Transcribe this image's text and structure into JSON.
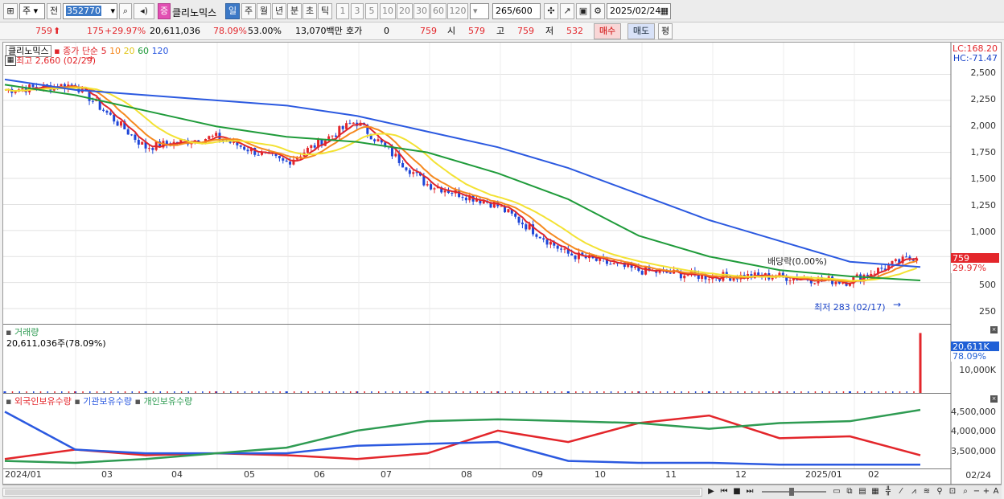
{
  "toolbar": {
    "market_sel": "주",
    "prefix_label": "전",
    "code_value": "352770",
    "stock_name": "클리노믹스",
    "kind_badge": "증",
    "periods": [
      "일",
      "주",
      "월",
      "년",
      "분",
      "초",
      "틱"
    ],
    "active_period": "일",
    "intervals": [
      "1",
      "3",
      "5",
      "10",
      "20",
      "30",
      "60",
      "120"
    ],
    "count_value": "265",
    "count_total": "/600",
    "date_value": "2025/02/24"
  },
  "quote": {
    "price": "759",
    "change": "175",
    "change_pct": "+29.97%",
    "volume": "20,611,036",
    "vol_ratio": "78.09%",
    "rate2": "53.00%",
    "amount": "13,070백만",
    "hoga_label": "호가",
    "hoga_value": "0",
    "hoga_price": "759",
    "open_label": "시",
    "open_value": "579",
    "high_label": "고",
    "high_value": "759",
    "low_label": "저",
    "low_value": "532",
    "buy_label": "매수",
    "sell_label": "매도",
    "avg_label": "평"
  },
  "price_panel": {
    "legend_name": "클리노믹스",
    "legend_ma": "종가 단순",
    "ma_periods": [
      "5",
      "10",
      "20",
      "60",
      "120"
    ],
    "lc_label": "LC:168.20",
    "hc_label": "HC:-71.47",
    "high_marker": "최고 2,660 (02/29)",
    "low_marker": "최저 283 (02/17)",
    "dividend_marker": "배당락(0.00%)",
    "last_price_tag": "759",
    "last_pct_tag": "29.97%",
    "y_ticks": [
      "2,500",
      "2,250",
      "2,000",
      "1,750",
      "1,500",
      "1,250",
      "1,000",
      "750",
      "500",
      "250"
    ]
  },
  "volume_panel": {
    "title": "거래량",
    "value_label": "20,611,036주(78.09%)",
    "tag_value": "20,611K",
    "tag_pct": "78.09%",
    "y_tick": "10,000K"
  },
  "holding_panel": {
    "legend": [
      "외국인보유수량",
      "기관보유수량",
      "개인보유수량"
    ],
    "y_ticks": [
      "4,500,000",
      "4,000,000",
      "3,500,000"
    ]
  },
  "x_axis": {
    "labels": [
      "2024/01",
      "03",
      "04",
      "05",
      "06",
      "07",
      "08",
      "09",
      "10",
      "11",
      "12",
      "2025/01",
      "02"
    ],
    "right_label": "02/24"
  },
  "colors": {
    "ma5": "#e0252b",
    "ma10": "#f5891f",
    "ma20": "#f3e233",
    "ma60": "#1f9b3a",
    "ma120": "#2b59e0",
    "up": "#e3262b",
    "down": "#1e46d8",
    "foreign": "#e3262b",
    "institution": "#2b59e0",
    "individual": "#2e9b52"
  },
  "chart_data": {
    "type": "line",
    "x": [
      "2024-01",
      "2024-02",
      "2024-03",
      "2024-04",
      "2024-05",
      "2024-06",
      "2024-07",
      "2024-08",
      "2024-09",
      "2024-10",
      "2024-11",
      "2024-12",
      "2025-01",
      "2025-02-24"
    ],
    "series": [
      {
        "name": "종가",
        "values": [
          2350,
          2400,
          1800,
          1900,
          1650,
          2050,
          1450,
          1250,
          780,
          620,
          560,
          560,
          510,
          759
        ]
      },
      {
        "name": "120",
        "values": [
          2450,
          2350,
          2300,
          2250,
          2200,
          2100,
          1950,
          1800,
          1600,
          1350,
          1100,
          900,
          700,
          650
        ]
      },
      {
        "name": "60",
        "values": [
          2400,
          2300,
          2150,
          2000,
          1900,
          1850,
          1750,
          1550,
          1300,
          950,
          750,
          620,
          560,
          520
        ]
      }
    ],
    "ylim": [
      250,
      2600
    ],
    "volume_k": [
      2,
      3,
      12,
      3,
      2,
      3,
      2,
      9,
      12,
      3,
      8,
      4,
      5,
      20611
    ],
    "holdings": {
      "외국인보유수량": [
        3350000,
        3600000,
        3450000,
        3500000,
        3450000,
        3350000,
        3500000,
        4100000,
        3800000,
        4300000,
        4500000,
        3900000,
        3950000,
        3450000
      ],
      "기관보유수량": [
        4600000,
        3600000,
        3500000,
        3500000,
        3500000,
        3700000,
        3750000,
        3800000,
        3300000,
        3250000,
        3250000,
        3200000,
        3200000,
        3200000
      ],
      "개인보유수량": [
        3300000,
        3250000,
        3350000,
        3500000,
        3650000,
        4100000,
        4350000,
        4400000,
        4350000,
        4300000,
        4150000,
        4300000,
        4350000,
        4650000
      ]
    }
  }
}
